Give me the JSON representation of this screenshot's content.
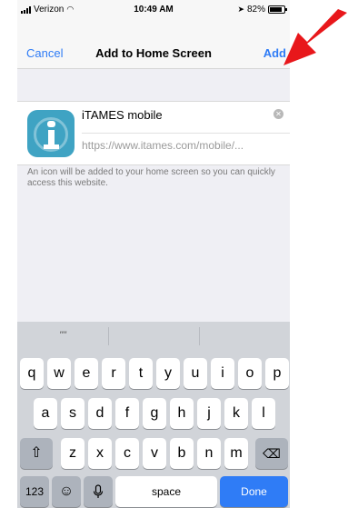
{
  "status_bar": {
    "carrier": "Verizon",
    "time": "10:49 AM",
    "battery": "82%"
  },
  "nav": {
    "cancel_label": "Cancel",
    "title": "Add to Home Screen",
    "add_label": "Add"
  },
  "bookmark": {
    "name": "iTAMES mobile",
    "url": "https://www.itames.com/mobile/..."
  },
  "description": "An icon will be added to your home screen so you can quickly access this website.",
  "keyboard": {
    "prediction": "\"\"",
    "row1": [
      "q",
      "w",
      "e",
      "r",
      "t",
      "y",
      "u",
      "i",
      "o",
      "p"
    ],
    "row2": [
      "a",
      "s",
      "d",
      "f",
      "g",
      "h",
      "j",
      "k",
      "l"
    ],
    "row3": [
      "z",
      "x",
      "c",
      "v",
      "b",
      "n",
      "m"
    ],
    "numbers_label": "123",
    "space_label": "space",
    "done_label": "Done"
  },
  "icons": {
    "shift": "shift-icon",
    "backspace": "backspace-icon",
    "emoji": "emoji-icon",
    "mic": "microphone-icon",
    "clear": "clear-icon",
    "arrow": "red-arrow-annotation"
  },
  "colors": {
    "accent": "#2f7cf6",
    "app_icon": "#3fa3c3",
    "arrow": "#e8171b",
    "done_key": "#2f7cf6"
  }
}
